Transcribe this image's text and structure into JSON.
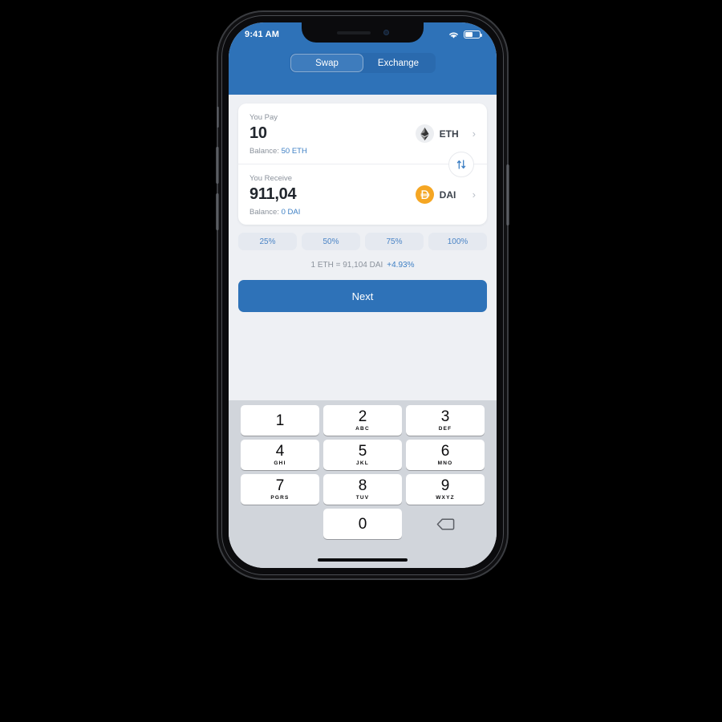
{
  "status_bar": {
    "time": "9:41 AM",
    "wifi_icon": "wifi-icon",
    "battery_icon": "battery-icon",
    "battery_level_pct": 55
  },
  "header": {
    "tabs": [
      {
        "label": "Swap",
        "active": true
      },
      {
        "label": "Exchange",
        "active": false
      }
    ],
    "background_color": "#2e72b8"
  },
  "swap_card": {
    "pay": {
      "label": "You Pay",
      "amount": "10",
      "token_symbol": "ETH",
      "token_icon": "ethereum-icon",
      "balance_label": "Balance:",
      "balance_value": "50 ETH",
      "chevron_icon": "chevron-right-icon"
    },
    "receive": {
      "label": "You Receive",
      "amount": "911,04",
      "token_symbol": "DAI",
      "token_icon": "dai-icon",
      "balance_label": "Balance:",
      "balance_value": "0 DAI",
      "chevron_icon": "chevron-right-icon"
    },
    "swap_toggle_icon": "swap-vertical-arrows-icon"
  },
  "percent_buttons": [
    {
      "label": "25%"
    },
    {
      "label": "50%"
    },
    {
      "label": "75%"
    },
    {
      "label": "100%"
    }
  ],
  "rate": {
    "text": "1 ETH = 91,104 DAI",
    "delta": "+4.93%",
    "delta_color": "#3d7fc4"
  },
  "primary_action": {
    "label": "Next"
  },
  "keypad": {
    "keys": [
      {
        "digit": "1",
        "letters": ""
      },
      {
        "digit": "2",
        "letters": "ABC"
      },
      {
        "digit": "3",
        "letters": "DEF"
      },
      {
        "digit": "4",
        "letters": "GHI"
      },
      {
        "digit": "5",
        "letters": "JKL"
      },
      {
        "digit": "6",
        "letters": "MNO"
      },
      {
        "digit": "7",
        "letters": "PGRS"
      },
      {
        "digit": "8",
        "letters": "TUV"
      },
      {
        "digit": "9",
        "letters": "WXYZ"
      },
      {
        "digit": "0",
        "letters": ""
      }
    ],
    "delete_icon": "backspace-icon"
  },
  "colors": {
    "brand_blue": "#2e72b8",
    "accent_link": "#3d7fc4",
    "dai_orange": "#f5a623",
    "screen_bg": "#eef0f4",
    "keypad_bg": "#d1d5db"
  }
}
